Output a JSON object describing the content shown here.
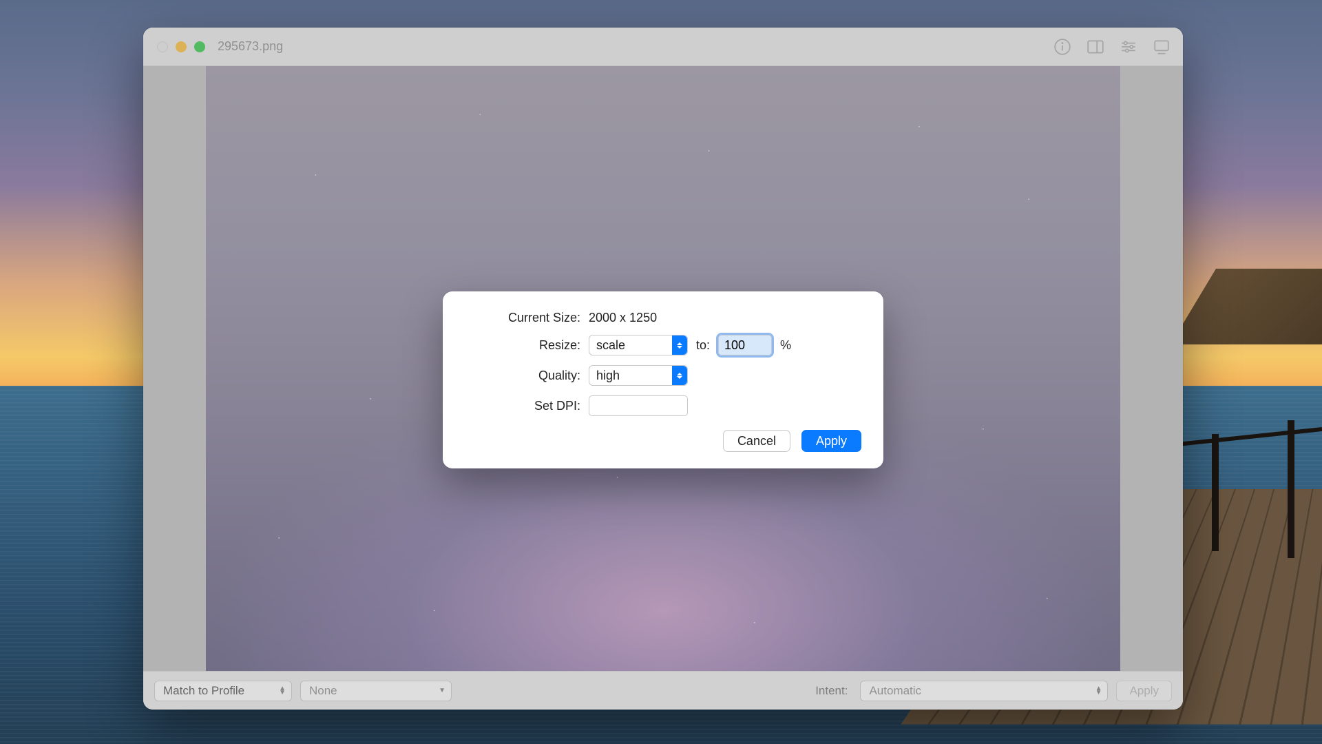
{
  "window": {
    "title": "295673.png"
  },
  "dialog": {
    "current_size_label": "Current Size:",
    "current_size_value": "2000 x 1250",
    "resize_label": "Resize:",
    "resize_mode": "scale",
    "to_label": "to:",
    "resize_value": "100",
    "resize_unit": "%",
    "quality_label": "Quality:",
    "quality_value": "high",
    "dpi_label": "Set DPI:",
    "dpi_value": "",
    "cancel": "Cancel",
    "apply": "Apply"
  },
  "bottombar": {
    "match_profile": "Match to Profile",
    "profile_value": "None",
    "intent_label": "Intent:",
    "intent_value": "Automatic",
    "apply": "Apply"
  }
}
